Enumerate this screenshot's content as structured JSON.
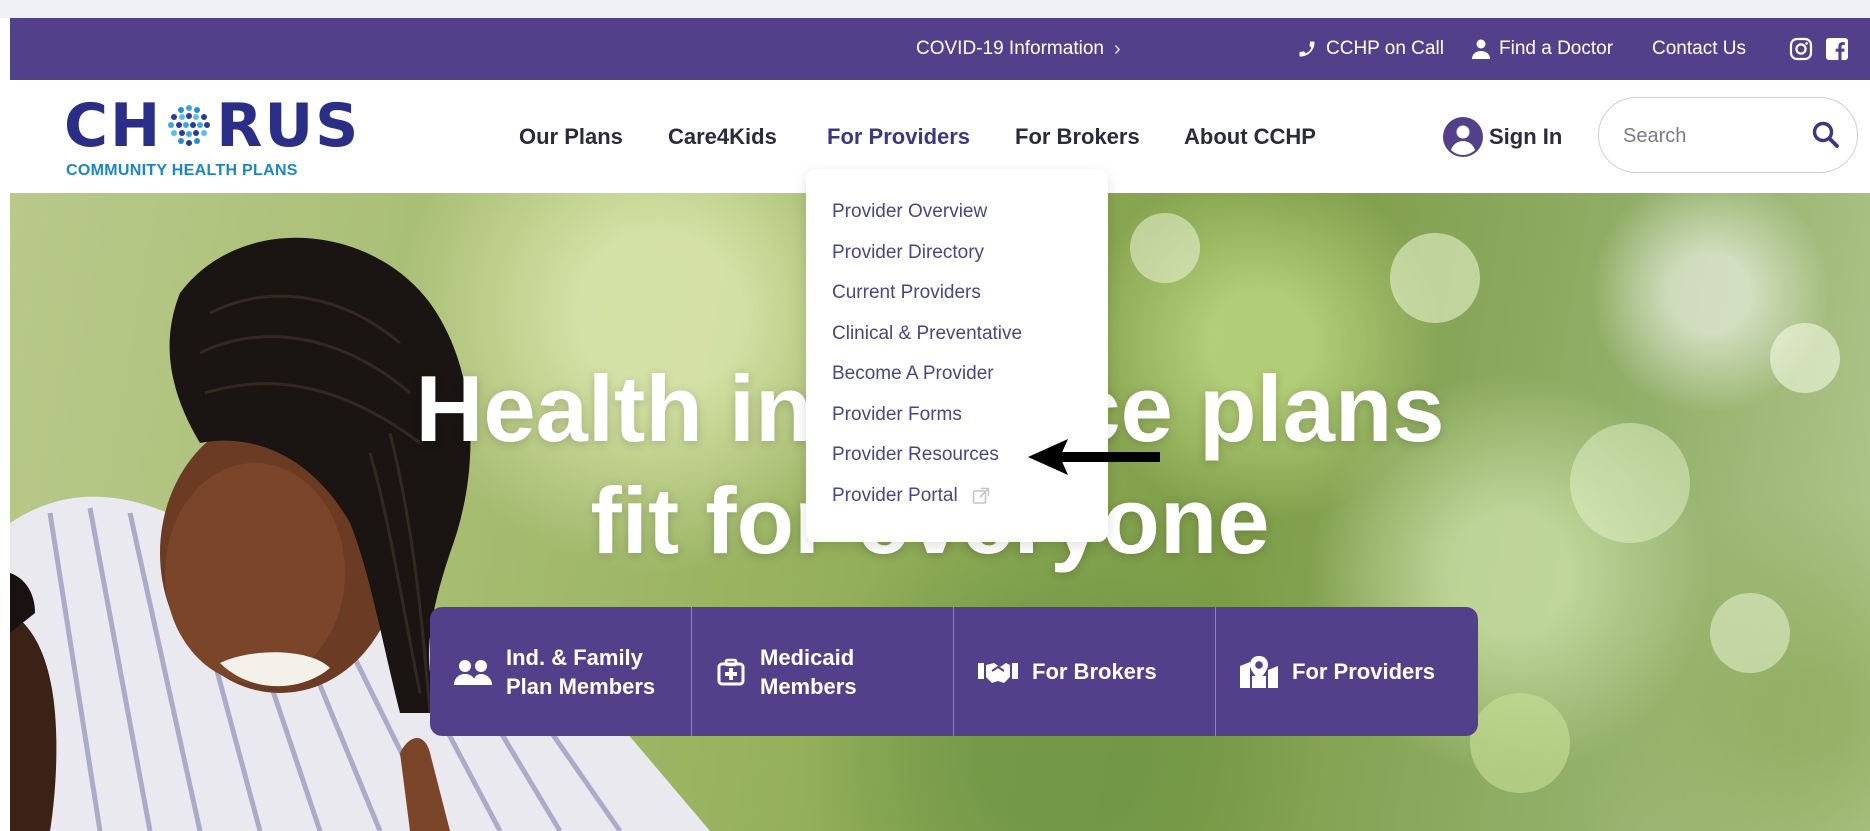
{
  "utility_bar": {
    "covid": "COVID-19 Information",
    "call": "CCHP on Call",
    "find_doctor": "Find a Doctor",
    "contact": "Contact Us"
  },
  "logo": {
    "word_left": "CH",
    "word_right": "RUS",
    "subtitle": "COMMUNITY HEALTH PLANS"
  },
  "nav": {
    "items": [
      {
        "label": "Our Plans"
      },
      {
        "label": "Care4Kids"
      },
      {
        "label": "For Providers"
      },
      {
        "label": "For Brokers"
      },
      {
        "label": "About CCHP"
      }
    ],
    "sign_in": "Sign In"
  },
  "search": {
    "placeholder": "Search"
  },
  "dropdown": {
    "items": [
      {
        "label": "Provider Overview"
      },
      {
        "label": "Provider Directory"
      },
      {
        "label": "Current Providers"
      },
      {
        "label": "Clinical & Preventative"
      },
      {
        "label": "Become A Provider"
      },
      {
        "label": "Provider Forms"
      },
      {
        "label": "Provider Resources"
      },
      {
        "label": "Provider Portal"
      }
    ]
  },
  "hero": {
    "title_line1": "Health insurance plans",
    "title_line2": "fit for everyone"
  },
  "quick_links": [
    {
      "line1": "Ind. & Family",
      "line2": "Plan Members",
      "icon": "users-icon"
    },
    {
      "line1": "Medicaid",
      "line2": "Members",
      "icon": "medical-kit-icon"
    },
    {
      "line1": "For Brokers",
      "line2": "",
      "icon": "handshake-icon"
    },
    {
      "line1": "For Providers",
      "line2": "",
      "icon": "map-marker-icon"
    }
  ],
  "colors": {
    "brand_purple": "#52418a",
    "logo_navy": "#2a2e86",
    "logo_blue": "#1c86c4",
    "menu_text": "#4b4680"
  }
}
